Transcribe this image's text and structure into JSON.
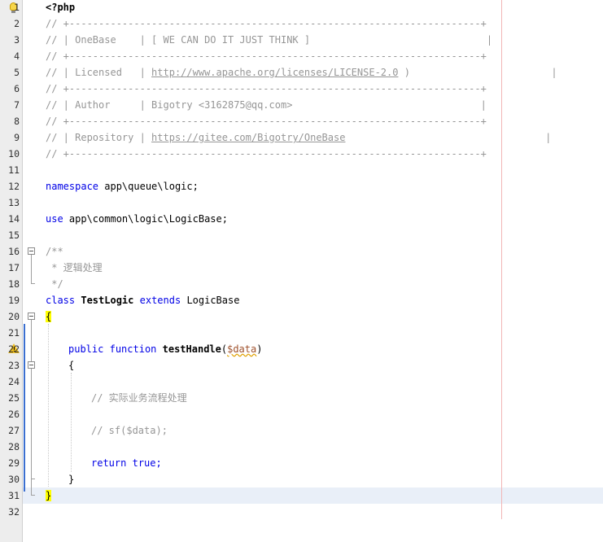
{
  "colors": {
    "keyword": "#0000e6",
    "comment": "#969696",
    "gutter_bg": "#ededed",
    "current_line": "#e9eff8",
    "brace_highlight": "#ffff00",
    "right_margin": "#f2b6b6"
  },
  "gutter": {
    "line_numbers": [
      "1",
      "2",
      "3",
      "4",
      "5",
      "6",
      "7",
      "8",
      "9",
      "10",
      "11",
      "12",
      "13",
      "14",
      "15",
      "16",
      "17",
      "18",
      "19",
      "20",
      "21",
      "22",
      "23",
      "24",
      "25",
      "26",
      "27",
      "28",
      "29",
      "30",
      "31",
      "32"
    ],
    "line1_icon": "lightbulb-icon",
    "line22_icon": "warning-icon"
  },
  "code": {
    "l1": "<?php",
    "l2": "// +----------------------------------------------------------------------+",
    "l3": "// | OneBase    | [ WE CAN DO IT JUST THINK ]                              |",
    "l4": "// +----------------------------------------------------------------------+",
    "l5_prefix": "// | Licensed   | ",
    "l5_link": "http://www.apache.org/licenses/LICENSE-2.0",
    "l5_suffix": " )                        |",
    "l6": "// +----------------------------------------------------------------------+",
    "l7": "// | Author     | Bigotry <3162875@qq.com>                                |",
    "l8": "// +----------------------------------------------------------------------+",
    "l9_prefix": "// | Repository | ",
    "l9_link": "https://gitee.com/Bigotry/OneBase",
    "l9_suffix": "                                  |",
    "l10": "// +----------------------------------------------------------------------+",
    "l12_kw": "namespace",
    "l12_rest": " app\\queue\\logic;",
    "l14_kw": "use",
    "l14_rest": " app\\common\\logic\\LogicBase;",
    "l16": "/**",
    "l17": " * 逻辑处理",
    "l18": " */",
    "l19_kw1": "class",
    "l19_name": "TestLogic",
    "l19_kw2": "extends",
    "l19_base": "LogicBase",
    "l20": "{",
    "l22_kw1": "public",
    "l22_kw2": "function",
    "l22_name": "testHandle",
    "l22_open": "(",
    "l22_var": "$data",
    "l22_close": ")",
    "l23": "{",
    "l25": "// 实际业务流程处理",
    "l27": "// sf($data);",
    "l29_kw1": "return",
    "l29_kw2": "true",
    "l29_semi": ";",
    "l30": "}",
    "l31": "}"
  }
}
